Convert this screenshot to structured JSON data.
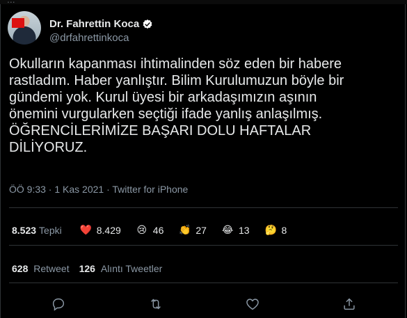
{
  "background_text": "...",
  "author": {
    "name": "Dr. Fahrettin Koca",
    "handle": "@drfahrettinkoca",
    "verified": true
  },
  "tweet": {
    "lines": [
      "Okulların kapanması ihtimalinden söz eden bir habere",
      "rastladım. Haber yanlıştır. Bilim Kurulumuzun böyle bir",
      "gündemi yok. Kurul üyesi bir arkadaşımızın aşının",
      "önemini vurgularken seçtiği ifade yanlış anlaşılmış.",
      "ÖĞRENCİLERİMİZE BAŞARI DOLU HAFTALAR",
      "DİLİYORUZ."
    ],
    "meta": "ÖÖ 9:33 · 1 Kas 2021 · Twitter for iPhone"
  },
  "reactions": {
    "total_count": "8.523",
    "total_label": "Tepki",
    "items": [
      {
        "icon": "heart-icon",
        "glyph": "❤️",
        "count": "8.429"
      },
      {
        "icon": "sad-face-icon",
        "glyph": "😢",
        "count": "46"
      },
      {
        "icon": "clapping-hands-icon",
        "glyph": "👏",
        "count": "27"
      },
      {
        "icon": "laughing-face-icon",
        "glyph": "😂",
        "count": "13"
      },
      {
        "icon": "thinking-face-icon",
        "glyph": "🤔",
        "count": "8"
      }
    ]
  },
  "stats": {
    "retweets_count": "628",
    "retweets_label": "Retweet",
    "quotes_count": "126",
    "quotes_label": "Alıntı Tweetler"
  },
  "actions": [
    "reply-icon",
    "retweet-icon",
    "like-icon",
    "share-icon"
  ],
  "colors": {
    "background": "#000000",
    "text": "#e7e9ea",
    "muted": "#8b98a5",
    "divider": "#2f3336",
    "verified": "#ffffff"
  }
}
